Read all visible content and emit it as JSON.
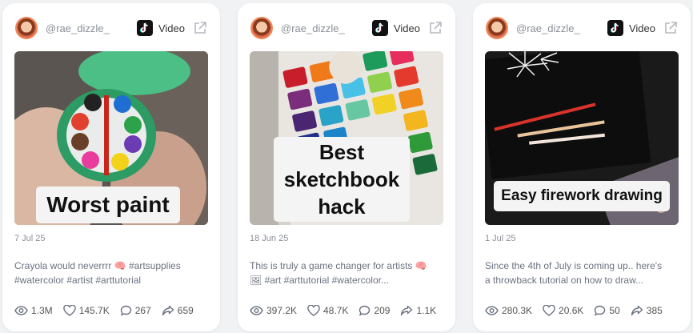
{
  "cards": [
    {
      "username": "@rae_dizzle_",
      "platform": "Video",
      "thumb_text": "Worst paint",
      "date": "7 Jul 25",
      "description_line1": "Crayola would neverrrr 🧠 #artsupplies",
      "description_line2": "#watercolor #artist #arttutorial",
      "views": "1.3M",
      "likes": "145.7K",
      "comments": "267",
      "shares": "659"
    },
    {
      "username": "@rae_dizzle_",
      "platform": "Video",
      "thumb_text_line1": "Best",
      "thumb_text_line2": "sketchbook",
      "thumb_text_line3": "hack",
      "date": "18 Jun 25",
      "description_line1": "This is truly a game changer for artists 🧠",
      "description_line2": "🖼 #art #arttutorial #watercolor...",
      "views": "397.2K",
      "likes": "48.7K",
      "comments": "209",
      "shares": "1.1K"
    },
    {
      "username": "@rae_dizzle_",
      "platform": "Video",
      "thumb_text": "Easy firework drawing",
      "date": "1 Jul 25",
      "description_line1": "Since the 4th of July is coming up.. here's",
      "description_line2": "a throwback tutorial on how to draw...",
      "views": "280.3K",
      "likes": "20.6K",
      "comments": "50",
      "shares": "385"
    }
  ],
  "icons": [
    "tiktok-icon",
    "external-link-icon",
    "eye-icon",
    "heart-icon",
    "comment-icon",
    "share-icon"
  ],
  "colors": {
    "card_bg": "#ffffff",
    "page_bg": "#f1f2f4",
    "muted_text": "#8a8f98",
    "avatar_ring": "#f08a5c"
  }
}
